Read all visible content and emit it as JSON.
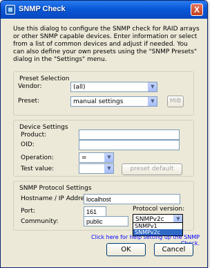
{
  "window": {
    "title": "SNMP Check",
    "close_label": "X"
  },
  "intro_text": "Use this dialog to configure the SNMP check for RAID arrays or other SNMP capable devices. Enter information or select from a list of common devices and adjust if needed. You can also define your own presets using the \"SNMP Presets\" dialog in the \"Settings\" menu.",
  "preset_selection": {
    "group_title": "Preset Selection",
    "vendor_label": "Vendor:",
    "vendor_value": "(all)",
    "preset_label": "Preset:",
    "preset_value": "manual settings",
    "mib_button": "MIB"
  },
  "device_settings": {
    "group_title": "Device Settings",
    "product_label": "Product:",
    "product_value": "",
    "oid_label": "OID:",
    "oid_value": "",
    "operation_label": "Operation:",
    "operation_value": "=",
    "test_value_label": "Test value:",
    "test_value_value": "",
    "preset_default_button": "preset default"
  },
  "protocol_settings": {
    "group_title": "SNMP Protocol Settings",
    "host_label": "Hostname / IP Address:",
    "host_value": "localhost",
    "port_label": "Port:",
    "port_value": "161",
    "community_label": "Community:",
    "community_value": "public",
    "protocol_version_label": "Protocol version:",
    "protocol_version_value": "SNMPv2c",
    "protocol_options": [
      "SNMPv1",
      "SNMPv2c"
    ]
  },
  "help_link": "Click here for help setting up the SNMP Check.",
  "buttons": {
    "ok": "OK",
    "cancel": "Cancel"
  }
}
